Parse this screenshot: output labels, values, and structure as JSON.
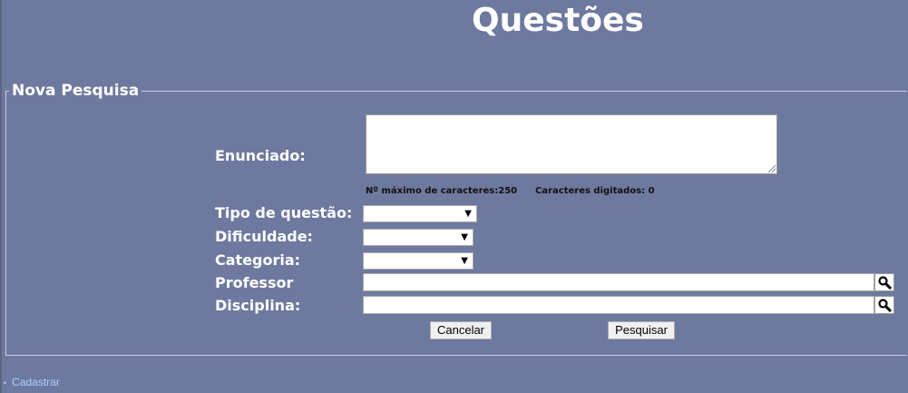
{
  "page": {
    "title": "Questões"
  },
  "form": {
    "legend": "Nova Pesquisa",
    "enunciado_label": "Enunciado:",
    "enunciado_value": "",
    "max_chars_text": "Nº máximo de caracteres:250",
    "typed_chars_text": "Caracteres digitados: 0",
    "tipo_label": "Tipo de questão:",
    "tipo_value": "",
    "dificuldade_label": "Dificuldade:",
    "dificuldade_value": "",
    "categoria_label": "Categoria:",
    "categoria_value": "",
    "professor_label": "Professor",
    "professor_value": "",
    "disciplina_label": "Disciplina:",
    "disciplina_value": "",
    "cancel_label": "Cancelar",
    "search_label": "Pesquisar"
  },
  "icons": {
    "lookup": "magnifier-icon",
    "dropdown": "triangle-down-icon"
  },
  "footer": {
    "link_label": "Cadastrar"
  },
  "colors": {
    "background": "#6e799f",
    "link": "#a9d1ff"
  }
}
